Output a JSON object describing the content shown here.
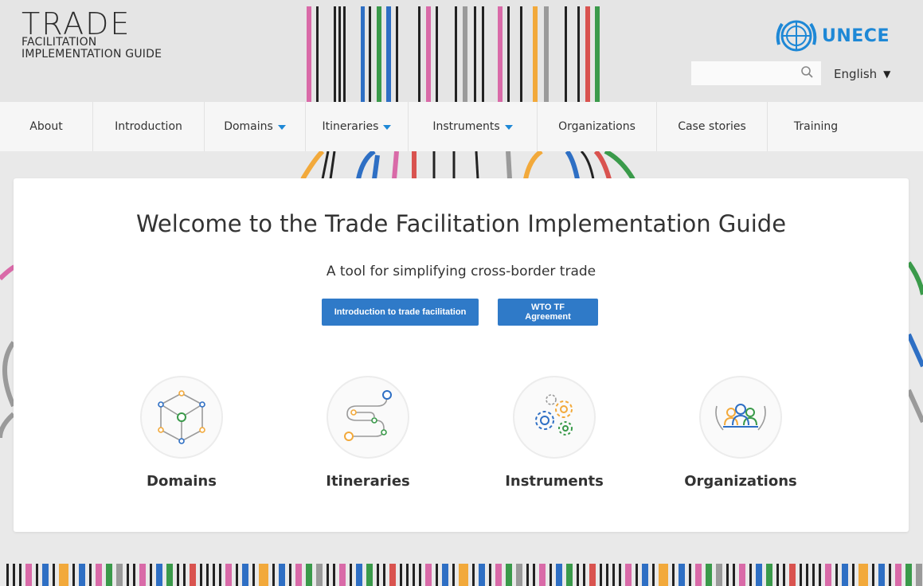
{
  "header": {
    "logo_title": "TRADE",
    "logo_line1": "FACILITATION",
    "logo_line2": "IMPLEMENTATION GUIDE",
    "brand": "UNECE",
    "language": "English"
  },
  "nav": {
    "items": [
      {
        "label": "About"
      },
      {
        "label": "Introduction"
      },
      {
        "label": "Domains"
      },
      {
        "label": "Itineraries"
      },
      {
        "label": "Instruments"
      },
      {
        "label": "Organizations"
      },
      {
        "label": "Case stories"
      },
      {
        "label": "Training"
      }
    ]
  },
  "main": {
    "title": "Welcome to the Trade Facilitation Implementation Guide",
    "subtitle": "A tool for simplifying cross-border trade",
    "button_intro": "Introduction to trade facilitation",
    "button_wto": "WTO TF Agreement",
    "features": [
      {
        "label": "Domains",
        "icon": "cube-network-icon"
      },
      {
        "label": "Itineraries",
        "icon": "path-nodes-icon"
      },
      {
        "label": "Instruments",
        "icon": "gears-icon"
      },
      {
        "label": "Organizations",
        "icon": "people-laurel-icon"
      }
    ]
  },
  "colors": {
    "accent": "#2f7ac8",
    "brand": "#1e88d6",
    "stripe_pink": "#d96aa8",
    "stripe_blue": "#2e6fc4",
    "stripe_green": "#3a9a4a",
    "stripe_orange": "#f2a93b",
    "stripe_gray": "#9a9a9a",
    "stripe_red": "#d9534f"
  }
}
